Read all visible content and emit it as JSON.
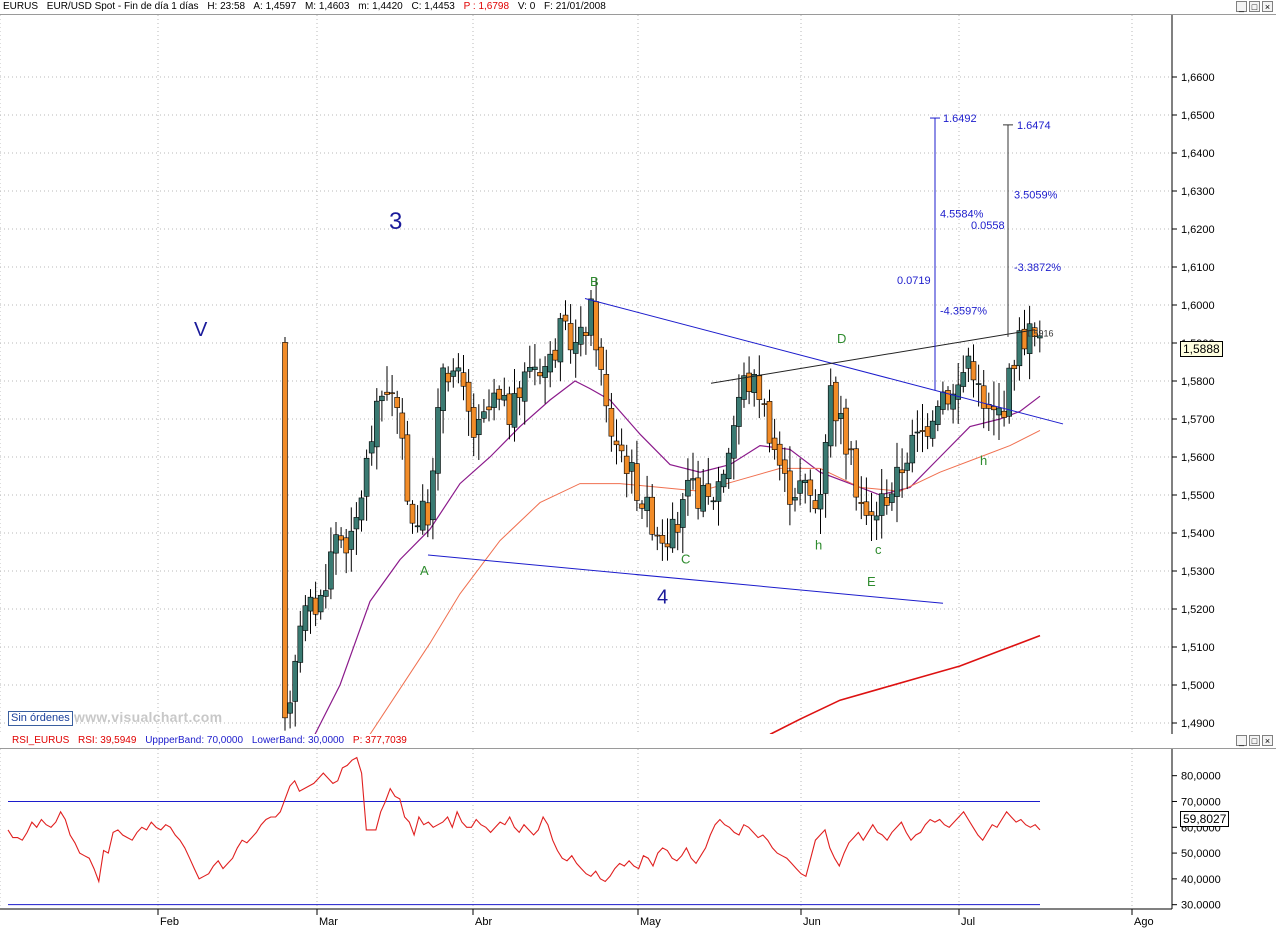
{
  "main_header": {
    "symbol": "EURUS",
    "description": "EUR/USD Spot - Fin de día 1 días",
    "h": "H: 23:58",
    "a": "A: 1,4597",
    "m": "M: 1,4603",
    "mi": "m: 1,4420",
    "c": "C: 1,4453",
    "p": "P : 1,6798",
    "v": "V: 0",
    "f": "F: 21/01/2008"
  },
  "rsi_header": {
    "name": "RSI_EURUS",
    "rsi": "RSI: 39,5949",
    "upper": "UppperBand: 70,0000",
    "lower": "LowerBand: 30,0000",
    "p": "P: 377,7039"
  },
  "window_buttons": [
    "_",
    "□",
    "×"
  ],
  "no_orders_label": "Sin órdenes",
  "watermark": "www.visualchart.com",
  "last_price_tag": "1,5888",
  "rsi_value_tag": "59,8027",
  "colors": {
    "bull": "#3a7a72",
    "bear": "#f28c28",
    "rsi": "#e02020",
    "band": "#1c1ccc",
    "ma20": "#8b1a8b",
    "ma50": "#f07050",
    "ma200": "#dd1111",
    "trend": "#1c1ccc",
    "resist": "#222222"
  },
  "chart_data": [
    {
      "type": "candlestick",
      "title": "",
      "y_axis": {
        "ticks": [
          "1,4900",
          "1,5000",
          "1,5100",
          "1,5200",
          "1,5300",
          "1,5400",
          "1,5500",
          "1,5600",
          "1,5700",
          "1,5800",
          "1,5900",
          "1,6000",
          "1,6100",
          "1,6200",
          "1,6300",
          "1,6400",
          "1,6500",
          "1,6600"
        ],
        "range": [
          1.487,
          1.672
        ]
      },
      "x_axis": {
        "month_labels": [
          "Feb",
          "Mar",
          "Abr",
          "May",
          "Jun",
          "Jul",
          "Ago"
        ]
      },
      "grid": true,
      "annotations": {
        "waves": [
          {
            "text": "3",
            "x": "mid-Feb",
            "y": 1.62
          },
          {
            "text": "V",
            "x": "early-Feb",
            "y": 1.594
          },
          {
            "text": "4",
            "x": "early-May",
            "y": 1.523
          }
        ],
        "points": [
          {
            "text": "A",
            "y": 1.529
          },
          {
            "text": "B",
            "y": 1.605
          },
          {
            "text": "C",
            "y": 1.532
          },
          {
            "text": "D",
            "y": 1.59
          },
          {
            "text": "E",
            "y": 1.526
          },
          {
            "text": "h",
            "y": 1.5357
          },
          {
            "text": "c",
            "y": 1.5345
          },
          {
            "text": "h",
            "y": 1.5579
          }
        ],
        "target1": {
          "price": "1.6492",
          "pct_up": "4.5584%",
          "points": "0.0719",
          "pct_down": "-4.3597%"
        },
        "target2": {
          "price": "1.6474",
          "pct_up": "3.5059%",
          "points": "0.0558",
          "pct_down": "-3.3872%"
        },
        "small_label": "1.5916"
      },
      "moving_averages": [
        "short",
        "medium",
        "long"
      ],
      "last_close": 1.5888
    },
    {
      "type": "line",
      "title": "",
      "series_name": "RSI",
      "y_axis": {
        "ticks": [
          "30,0000",
          "40,0000",
          "50,0000",
          "60,0000",
          "70,0000",
          "80,0000"
        ],
        "range": [
          26,
          90
        ]
      },
      "upper_band": 70,
      "lower_band": 30,
      "values": [
        59,
        56,
        56,
        55,
        58,
        62,
        60,
        63,
        61,
        60,
        62,
        66,
        63,
        57,
        54,
        50,
        49,
        48,
        44,
        39,
        51,
        50,
        58,
        59,
        57,
        56,
        55,
        58,
        60,
        59,
        62,
        60,
        59,
        61,
        60,
        57,
        55,
        52,
        48,
        44,
        40,
        41,
        42,
        45,
        47,
        44,
        46,
        48,
        52,
        55,
        54,
        56,
        58,
        61,
        63,
        64,
        64,
        66,
        71,
        76,
        78,
        74,
        75,
        76,
        77,
        79,
        81,
        79,
        77,
        78,
        83,
        84,
        86,
        87,
        81,
        59,
        59,
        59,
        66,
        70,
        75,
        72,
        71,
        64,
        62,
        57,
        64,
        61,
        62,
        60,
        61,
        62,
        64,
        60,
        66,
        62,
        60,
        60,
        63,
        61,
        60,
        58,
        60,
        62,
        61,
        64,
        60,
        58,
        61,
        59,
        57,
        59,
        64,
        61,
        55,
        51,
        48,
        47,
        49,
        46,
        44,
        42,
        41,
        43,
        40,
        39,
        41,
        44,
        46,
        45,
        47,
        45,
        44,
        49,
        48,
        45,
        50,
        52,
        51,
        48,
        47,
        49,
        52,
        48,
        46,
        49,
        52,
        57,
        61,
        63,
        61,
        60,
        58,
        57,
        61,
        60,
        58,
        56,
        57,
        55,
        52,
        50,
        49,
        48,
        46,
        44,
        42,
        41,
        48,
        55,
        57,
        59,
        52,
        48,
        45,
        50,
        54,
        56,
        58,
        55,
        58,
        61,
        58,
        57,
        55,
        58,
        60,
        62,
        58,
        55,
        57,
        58,
        61,
        63,
        62,
        63,
        61,
        60,
        62,
        64,
        66,
        63,
        60,
        57,
        55,
        58,
        61,
        60,
        63,
        66,
        64,
        62,
        63,
        61,
        60,
        61,
        59
      ]
    }
  ]
}
